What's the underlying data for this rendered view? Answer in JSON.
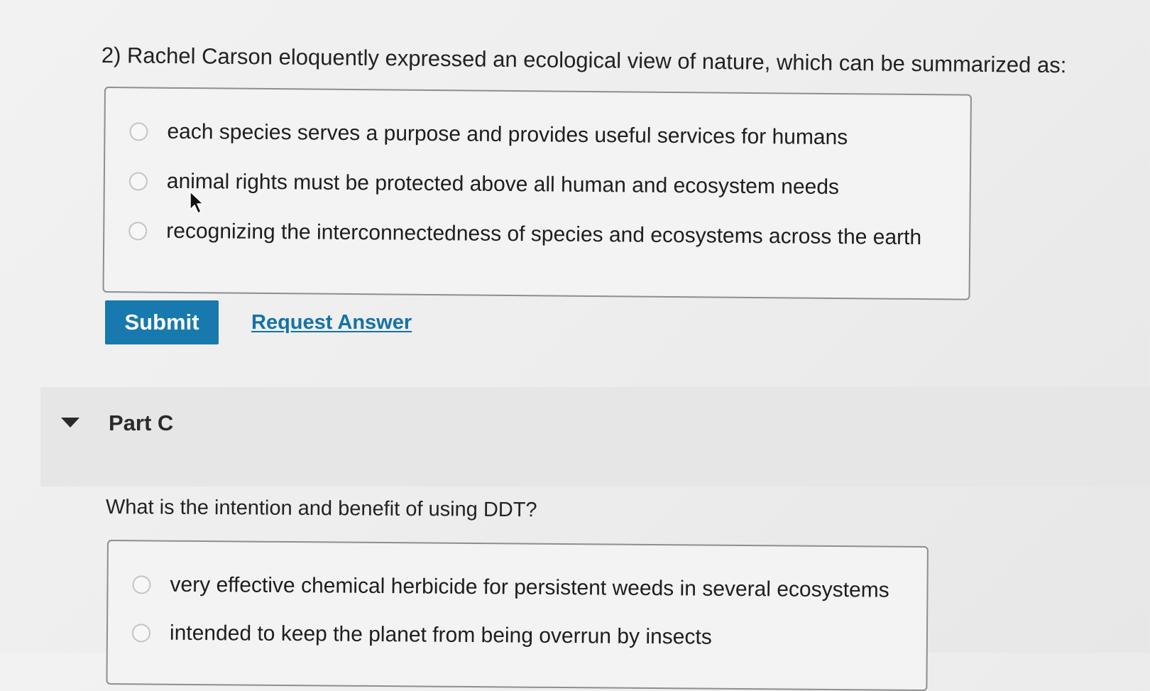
{
  "part_b": {
    "question": "2) Rachel Carson eloquently expressed an ecological view of nature, which can be summarized as:",
    "options": [
      "each species serves a purpose and provides useful services for humans",
      "animal rights must be protected above all human and ecosystem needs",
      "recognizing the interconnectedness of species and ecosystems across the earth"
    ],
    "submit_label": "Submit",
    "request_answer_label": "Request Answer"
  },
  "part_c": {
    "title": "Part C",
    "question": "What is the intention and benefit of using DDT?",
    "options": [
      "very effective chemical herbicide for persistent weeds in several ecosystems",
      "intended to keep the planet from being overrun by insects"
    ]
  },
  "icons": {
    "collapse_toggle": "caret-down-icon",
    "mouse_pointer": "mouse-cursor-icon",
    "radio": "radio-unselected-icon"
  },
  "colors": {
    "submit_button": "#1879ae",
    "link": "#1573a6",
    "background": "#efefef",
    "part_header_band": "#e6e6e6"
  }
}
